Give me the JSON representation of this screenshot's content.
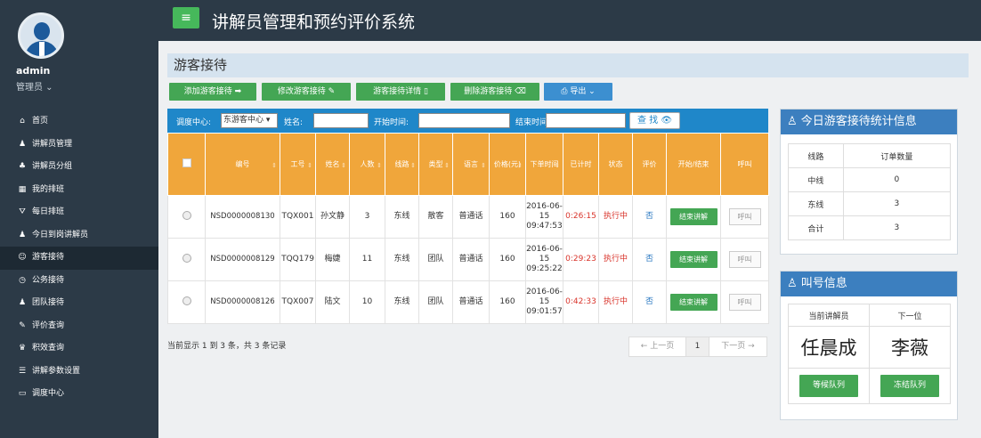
{
  "app": {
    "title": "讲解员管理和预约评价系统",
    "menu_icon": "≡"
  },
  "user": {
    "name": "admin",
    "role": "管理员 ⌄"
  },
  "menu": [
    {
      "label": "首页",
      "icon": "home-icon",
      "glyph": "⌂"
    },
    {
      "label": "讲解员管理",
      "icon": "user-icon",
      "glyph": "♟"
    },
    {
      "label": "讲解员分组",
      "icon": "sitemap-icon",
      "glyph": "♣"
    },
    {
      "label": "我的排班",
      "icon": "calendar-icon",
      "glyph": "▦"
    },
    {
      "label": "每日排班",
      "icon": "filter-icon",
      "glyph": "⛛"
    },
    {
      "label": "今日到岗讲解员",
      "icon": "user-plus-icon",
      "glyph": "♟"
    },
    {
      "label": "游客接待",
      "icon": "smile-icon",
      "glyph": "☺"
    },
    {
      "label": "公务接待",
      "icon": "clock-icon",
      "glyph": "◷"
    },
    {
      "label": "团队接待",
      "icon": "users-icon",
      "glyph": "♟"
    },
    {
      "label": "评价查询",
      "icon": "edit-icon",
      "glyph": "✎"
    },
    {
      "label": "积效查询",
      "icon": "trophy-icon",
      "glyph": "♛"
    },
    {
      "label": "讲解参数设置",
      "icon": "sliders-icon",
      "glyph": "☰"
    },
    {
      "label": "调度中心",
      "icon": "monitor-icon",
      "glyph": "▭"
    }
  ],
  "page": {
    "title": "游客接待"
  },
  "toolbar": {
    "add": "添加游客接待 ➡",
    "edit": "修改游客接待 ✎",
    "detail": "游客接待详情 ▯",
    "delete": "删除游客接待 ⌫",
    "export": "⎙ 导出 ⌄"
  },
  "search": {
    "center_label": "调度中心:",
    "center_value": "东游客中心 ▾",
    "name_label": "姓名:",
    "start_label": "开始时间:",
    "end_label": "结束时间:",
    "button": "查 找 👁"
  },
  "grid": {
    "headers": [
      "",
      "编号",
      "工号",
      "姓名",
      "人数",
      "线路",
      "类型",
      "语言",
      "价格(元)",
      "下单时间",
      "已计时",
      "状态",
      "评价",
      "开始/结束",
      "呼叫"
    ],
    "rows": [
      {
        "id": "NSD0000008130",
        "code": "TQX001",
        "name": "孙文静",
        "count": "3",
        "route": "东线",
        "type": "散客",
        "lang": "普通话",
        "price": "160",
        "time": "2016-06-15 09:47:53",
        "elapsed": "0:26:15",
        "status": "执行中",
        "review": "否",
        "action": "结束讲解",
        "call": "呼叫"
      },
      {
        "id": "NSD0000008129",
        "code": "TQQ179",
        "name": "梅婕",
        "count": "11",
        "route": "东线",
        "type": "团队",
        "lang": "普通话",
        "price": "160",
        "time": "2016-06-15 09:25:22",
        "elapsed": "0:29:23",
        "status": "执行中",
        "review": "否",
        "action": "结束讲解",
        "call": "呼叫"
      },
      {
        "id": "NSD0000008126",
        "code": "TQX007",
        "name": "陆文",
        "count": "10",
        "route": "东线",
        "type": "团队",
        "lang": "普通话",
        "price": "160",
        "time": "2016-06-15 09:01:57",
        "elapsed": "0:42:33",
        "status": "执行中",
        "review": "否",
        "action": "结束讲解",
        "call": "呼叫"
      }
    ]
  },
  "pagination": {
    "info": "当前显示 1 到 3 条，共 3 条记录",
    "prev": "← 上一页",
    "current": "1",
    "next": "下一页 →"
  },
  "stats": {
    "title": "♙ 今日游客接待统计信息",
    "col_route": "线路",
    "col_count": "订单数量",
    "rows": [
      {
        "route": "中线",
        "count": "0"
      },
      {
        "route": "东线",
        "count": "3"
      },
      {
        "route": "合计",
        "count": "3"
      }
    ]
  },
  "calling": {
    "title": "♙ 叫号信息",
    "col_current": "当前讲解员",
    "col_next": "下一位",
    "current": "任晨成",
    "next": "李薇",
    "wait_btn": "等候队列",
    "frozen_btn": "冻结队列"
  }
}
